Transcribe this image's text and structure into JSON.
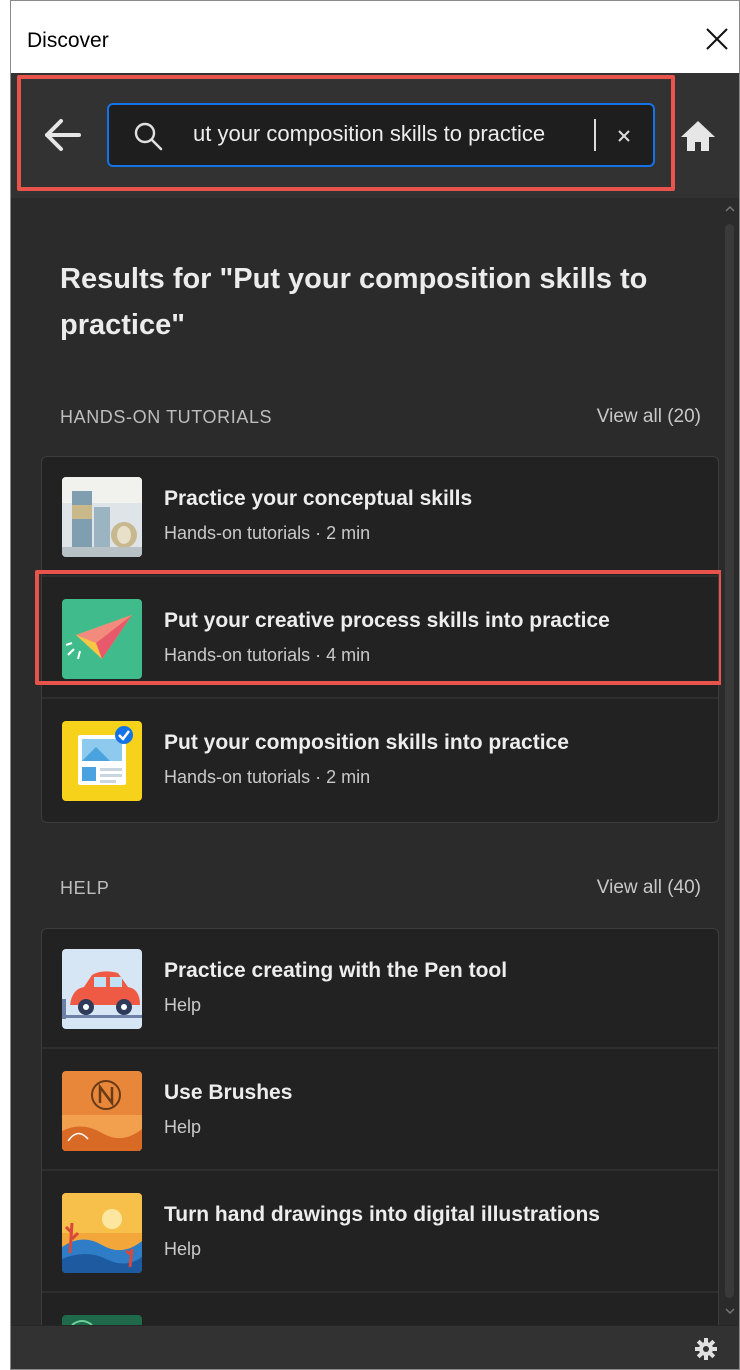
{
  "window": {
    "title": "Discover"
  },
  "search": {
    "value": "ut your composition skills to practice"
  },
  "results": {
    "heading": "Results for \"Put your composition skills to practice\""
  },
  "sections": {
    "tutorials": {
      "label": "HANDS-ON TUTORIALS",
      "view_all": "View all (20)",
      "items": [
        {
          "title": "Practice your conceptual skills",
          "meta": "Hands-on tutorials · 2 min",
          "icon": "conceptual-skills-thumbnail"
        },
        {
          "title": "Put your creative process skills into practice",
          "meta": "Hands-on tutorials · 4 min",
          "icon": "paper-plane-thumbnail"
        },
        {
          "title": "Put your composition skills into practice",
          "meta": "Hands-on tutorials · 2 min",
          "icon": "composition-layout-thumbnail"
        }
      ]
    },
    "help": {
      "label": "HELP",
      "view_all": "View all (40)",
      "items": [
        {
          "title": "Practice creating with the Pen tool",
          "meta": "Help",
          "icon": "car-drawing-thumbnail"
        },
        {
          "title": "Use Brushes",
          "meta": "Help",
          "icon": "brush-map-thumbnail"
        },
        {
          "title": "Turn hand drawings into digital illustrations",
          "meta": "Help",
          "icon": "sunset-illustration-thumbnail"
        }
      ]
    }
  },
  "colors": {
    "accent": "#1473e6",
    "highlight": "#e8544b",
    "background": "#2b2b2b",
    "card": "#222222"
  }
}
